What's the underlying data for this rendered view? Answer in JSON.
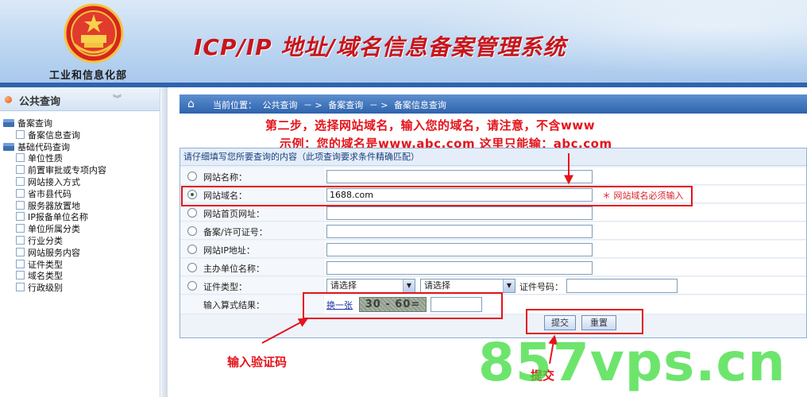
{
  "header": {
    "ministry": "工业和信息化部",
    "title": "ICP/IP 地址/域名信息备案管理系统"
  },
  "sidebar": {
    "title": "公共查询",
    "tree": [
      {
        "label": "备案查询",
        "level": 1,
        "icon": "folder-icon"
      },
      {
        "label": "备案信息查询",
        "level": 2,
        "icon": "page-icon"
      },
      {
        "label": "基础代码查询",
        "level": 1,
        "icon": "folder-icon"
      },
      {
        "label": "单位性质",
        "level": 2,
        "icon": "page-icon"
      },
      {
        "label": "前置审批或专项内容",
        "level": 2,
        "icon": "page-icon"
      },
      {
        "label": "网站接入方式",
        "level": 2,
        "icon": "page-icon"
      },
      {
        "label": "省市县代码",
        "level": 2,
        "icon": "page-icon"
      },
      {
        "label": "服务器放置地",
        "level": 2,
        "icon": "page-icon"
      },
      {
        "label": "IP报备单位名称",
        "level": 2,
        "icon": "page-icon"
      },
      {
        "label": "单位所属分类",
        "level": 2,
        "icon": "page-icon"
      },
      {
        "label": "行业分类",
        "level": 2,
        "icon": "page-icon"
      },
      {
        "label": "网站服务内容",
        "level": 2,
        "icon": "page-icon"
      },
      {
        "label": "证件类型",
        "level": 2,
        "icon": "page-icon"
      },
      {
        "label": "域名类型",
        "level": 2,
        "icon": "page-icon"
      },
      {
        "label": "行政级别",
        "level": 2,
        "icon": "page-icon"
      }
    ]
  },
  "breadcrumb": {
    "prefix": "当前位置：",
    "items": [
      "公共查询",
      "－ >",
      "备案查询",
      "－ >",
      "备案信息查询"
    ]
  },
  "annotations": {
    "step2": "第二步，选择网站域名，输入您的域名，请注意，不含www",
    "example": "示例：您的域名是www.abc.com 这里只能输：abc.com",
    "captcha_hint": "输入验证码",
    "submit_hint": "提交"
  },
  "form": {
    "instructions": "请仔细填写您所要查询的内容（此项查询要求条件精确匹配）",
    "fields": [
      {
        "label": "网站名称：",
        "value": "",
        "selected": false
      },
      {
        "label": "网站域名：",
        "value": "1688.com",
        "selected": true,
        "required_note": "＊ 网站域名必须输入"
      },
      {
        "label": "网站首页网址：",
        "value": "",
        "selected": false
      },
      {
        "label": "备案/许可证号：",
        "value": "",
        "selected": false
      },
      {
        "label": "网站IP地址：",
        "value": "",
        "selected": false
      },
      {
        "label": "主办单位名称：",
        "value": "",
        "selected": false
      }
    ],
    "cert": {
      "label": "证件类型：",
      "select1": "请选择",
      "select2": "请选择",
      "number_label": "证件号码："
    },
    "captcha": {
      "label": "输入算式结果：",
      "refresh_link": "换一张",
      "image_text": "30 - 60=",
      "value": ""
    },
    "buttons": {
      "submit": "提交",
      "reset": "重置"
    }
  },
  "watermark": "857vps.cn",
  "colors": {
    "accent": "#2f64ad",
    "annotation": "#e4141b",
    "title": "#c8151b",
    "watermark": "#3cdc3c"
  }
}
